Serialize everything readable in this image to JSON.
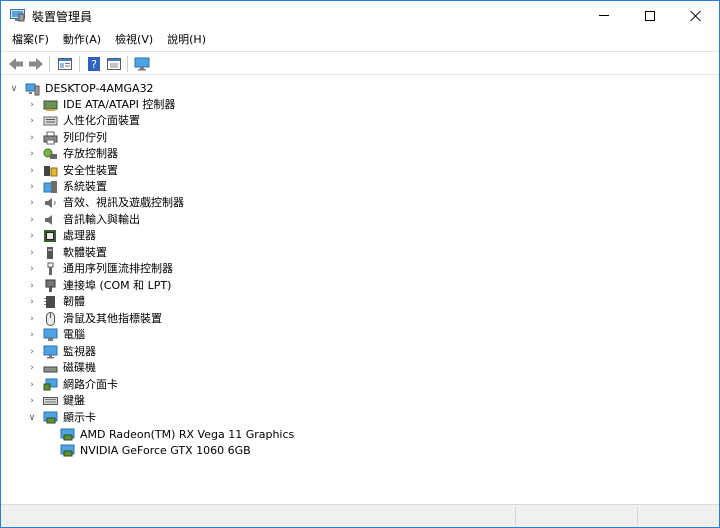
{
  "window": {
    "title": "裝置管理員"
  },
  "menu": [
    "檔案(F)",
    "動作(A)",
    "檢視(V)",
    "說明(H)"
  ],
  "toolbar": {
    "buttons": [
      "back-arrow-icon",
      "forward-arrow-icon",
      "properties-icon",
      "help-icon",
      "update-driver-icon",
      "monitor-icon"
    ]
  },
  "tree": {
    "root": "DESKTOP-4AMGA32",
    "categories": [
      {
        "label": "IDE ATA/ATAPI 控制器",
        "icon": "ide-controller-icon"
      },
      {
        "label": "人性化介面裝置",
        "icon": "hid-icon"
      },
      {
        "label": "列印佇列",
        "icon": "printer-icon"
      },
      {
        "label": "存放控制器",
        "icon": "storage-controller-icon"
      },
      {
        "label": "安全性裝置",
        "icon": "security-device-icon"
      },
      {
        "label": "系統裝置",
        "icon": "system-device-icon"
      },
      {
        "label": "音效、視訊及遊戲控制器",
        "icon": "speaker-icon"
      },
      {
        "label": "音訊輸入與輸出",
        "icon": "audio-io-icon"
      },
      {
        "label": "處理器",
        "icon": "processor-icon"
      },
      {
        "label": "軟體裝置",
        "icon": "software-device-icon"
      },
      {
        "label": "通用序列匯流排控制器",
        "icon": "usb-icon"
      },
      {
        "label": "連接埠 (COM 和 LPT)",
        "icon": "port-icon"
      },
      {
        "label": "韌體",
        "icon": "firmware-icon"
      },
      {
        "label": "滑鼠及其他指標裝置",
        "icon": "mouse-icon"
      },
      {
        "label": "電腦",
        "icon": "computer-icon"
      },
      {
        "label": "監視器",
        "icon": "monitor-icon"
      },
      {
        "label": "磁碟機",
        "icon": "disk-drive-icon"
      },
      {
        "label": "網路介面卡",
        "icon": "network-adapter-icon"
      },
      {
        "label": "鍵盤",
        "icon": "keyboard-icon"
      },
      {
        "label": "顯示卡",
        "icon": "display-adapter-icon"
      }
    ],
    "display_adapters": [
      "AMD Radeon(TM) RX Vega 11 Graphics",
      "NVIDIA GeForce GTX 1060 6GB"
    ]
  }
}
